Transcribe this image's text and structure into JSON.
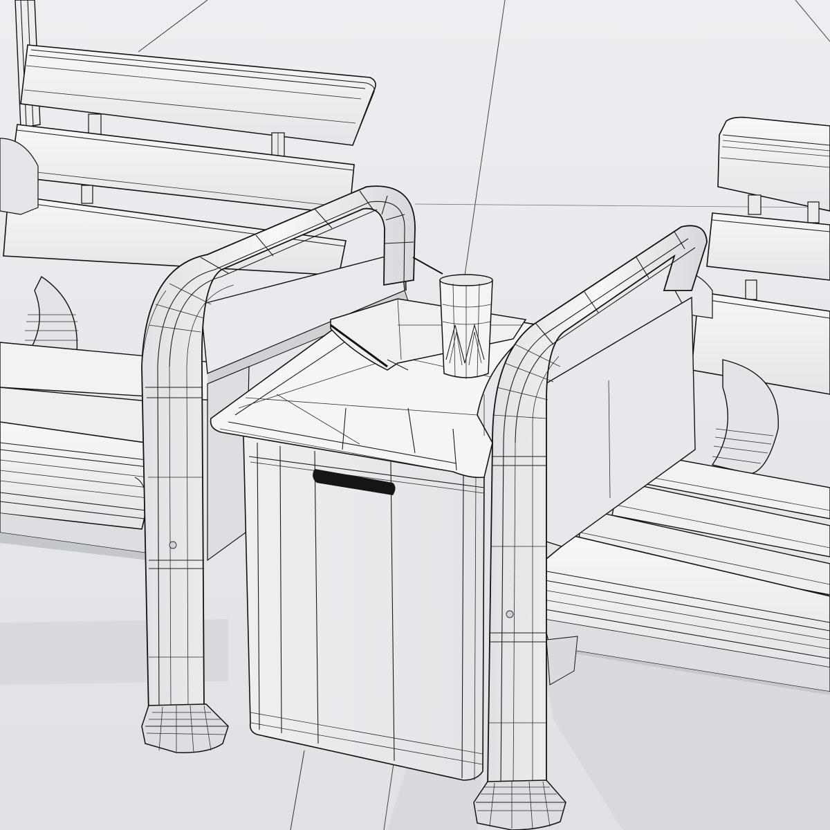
{
  "scene": {
    "kind": "3d-wireframe-render",
    "subject": "two-outdoor-lounge-chairs-with-side-table",
    "palette": {
      "background": "#e6e8eb",
      "surface": "#f2f3f5",
      "shadow": "#c9ccd1",
      "deep-shadow": "#b7bac0",
      "wire": "#1a1a1a"
    }
  }
}
